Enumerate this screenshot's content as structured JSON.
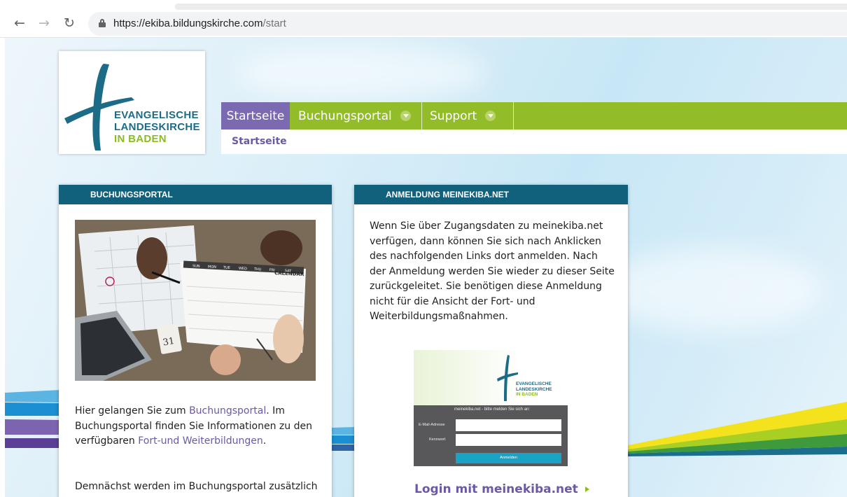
{
  "browser": {
    "url_domain": "https://ekiba.bildungskirche.com",
    "url_path": "/start"
  },
  "logo": {
    "line1": "EVANGELISCHE",
    "line2": "LANDESKIRCHE",
    "line3": "IN BADEN"
  },
  "nav": {
    "items": [
      {
        "label": "Startseite",
        "active": true,
        "has_dropdown": false
      },
      {
        "label": "Buchungsportal",
        "active": false,
        "has_dropdown": true
      },
      {
        "label": "Support",
        "active": false,
        "has_dropdown": true
      }
    ],
    "breadcrumb": "Startseite"
  },
  "cards": {
    "buchungsportal": {
      "title": "BUCHUNGSPORTAL",
      "calendar_label": "CALENDAR",
      "calendar_days": [
        "SUN",
        "MON",
        "TUE",
        "WED",
        "THU",
        "FRI",
        "SAT"
      ],
      "desk_calendar_day": "31",
      "text_before": "Hier gelangen Sie zum ",
      "link1": "Buchungsportal",
      "text_mid": ". Im Buchungsportal finden Sie Informationen zu den verfügbaren ",
      "link2": "Fort-und Weiterbildungen",
      "text_after": ".",
      "paragraph2": "Demnächst werden im Buchungsportal zusätzlich"
    },
    "anmeldung": {
      "title": "ANMELDUNG MEINEKIBA.NET",
      "paragraph": "Wenn Sie über Zugangsdaten zu meinekiba.net verfügen, dann können Sie sich nach Anklicken des nachfolgenden Links dort anmelden. Nach der Anmeldung werden Sie wieder zu dieser Seite zurückgeleitet. Sie benötigen diese Anmeldung nicht für die Ansicht der Fort- und Weiterbildungsmaßnahmen.",
      "preview": {
        "logo_line1": "EVANGELISCHE",
        "logo_line2": "LANDESKIRCHE",
        "logo_line3": "IN BADEN",
        "prompt": "meinekiba.net - bitte melden Sie sich an:",
        "email_label": "E-Mail-Adresse",
        "password_label": "Kennwort",
        "button_label": "Anmelden"
      },
      "login_link": "Login mit meinekiba.net"
    }
  },
  "colors": {
    "nav_green": "#93bd28",
    "nav_active_purple": "#7b69b2",
    "card_header_teal": "#11607c",
    "link_purple": "#6c59a6",
    "logo_teal": "#1c6c88",
    "logo_green": "#8cbc22"
  }
}
